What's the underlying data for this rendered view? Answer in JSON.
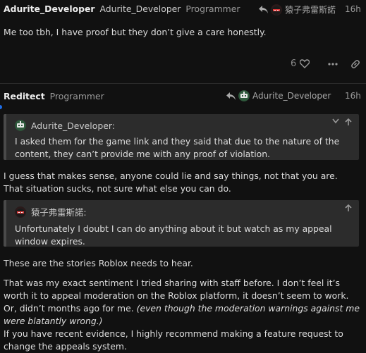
{
  "post1": {
    "username": "Adurite_Developer",
    "full_name": "Adurite_Developer",
    "user_title": "Programmer",
    "reply_to_name": "猿子弗雷斯諾",
    "time": "16h",
    "body": "Me too tbh, I have proof but they don’t give a care honestly.",
    "like_count": "6"
  },
  "post2": {
    "username": "Reditect",
    "user_title": "Programmer",
    "reply_to_name": "Adurite_Developer",
    "time": "16h",
    "quote1": {
      "author": "Adurite_Developer:",
      "text": "I asked them for the game link and they said that due to the nature of the content, they can’t provide me with any proof of violation."
    },
    "para1": "I guess that makes sense, anyone could lie and say things, not that you are. That situation sucks, not sure what else you can do.",
    "quote2": {
      "author": "猿子弗雷斯諾:",
      "text": "Unfortunately I doubt I can do anything about it but watch as my appeal window expires."
    },
    "para2": "These are the stories Roblox needs to hear.",
    "para3_text": "That was my exact sentiment I tried sharing with staff before. I don’t feel it’s worth it to appeal moderation on the Roblox platform, it doesn’t seem to work. Or, didn’t months ago for me.",
    "para3_italic": "(even though the moderation warnings against me were blatantly wrong.)",
    "para4": "If you have recent evidence, I highly recommend making a feature request to change the appeals system."
  },
  "icons": {
    "reply": "reply-arrow-icon",
    "like": "heart-icon",
    "more": "more-options-icon",
    "link": "link-icon",
    "expand": "chevron-down-icon",
    "collapse": "arrow-up-icon"
  }
}
